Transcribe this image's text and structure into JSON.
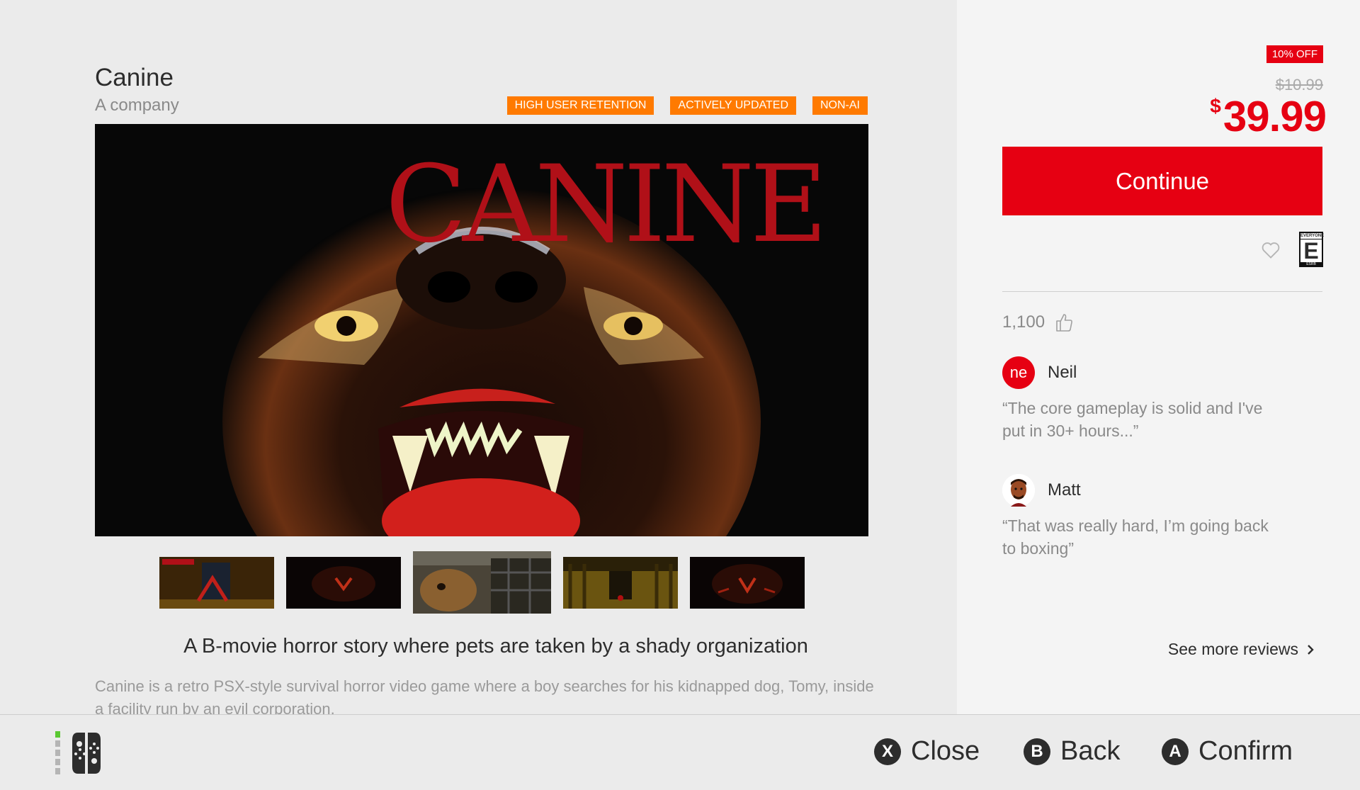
{
  "game": {
    "title": "Canine",
    "publisher": "A company",
    "tags": [
      "HIGH USER RETENTION",
      "ACTIVELY UPDATED",
      "NON-AI"
    ],
    "hero_logo": "CANINE",
    "headline": "A B-movie horror story where pets are taken by a shady organization",
    "description": "Canine is a retro PSX-style survival horror video game where a boy searches for his kidnapped dog, Tomy, inside a facility run by an evil corporation.",
    "thumbnail_selected_index": 2,
    "thumbnail_count": 5
  },
  "purchase": {
    "discount_badge": "10% OFF",
    "original_price": "$10.99",
    "currency_symbol": "$",
    "price": "39.99",
    "continue_label": "Continue",
    "rating_icon": "esrb-everyone-icon",
    "rating_letter": "E",
    "rating_top": "EVERYONE",
    "rating_bottom": "ESRB"
  },
  "reviews": {
    "likes_count": "1,100",
    "items": [
      {
        "avatar_text": "ne",
        "name": "Neil",
        "text": "“The core gameplay is solid and I've put in 30+ hours...”"
      },
      {
        "avatar_text": "",
        "name": "Matt",
        "text": "“That was really hard, I’m going back to boxing”"
      }
    ],
    "see_more": "See more reviews"
  },
  "footer": {
    "close_key": "X",
    "close_label": "Close",
    "back_key": "B",
    "back_label": "Back",
    "confirm_key": "A",
    "confirm_label": "Confirm"
  },
  "colors": {
    "accent": "#e60012",
    "tag": "#ff7a00"
  }
}
